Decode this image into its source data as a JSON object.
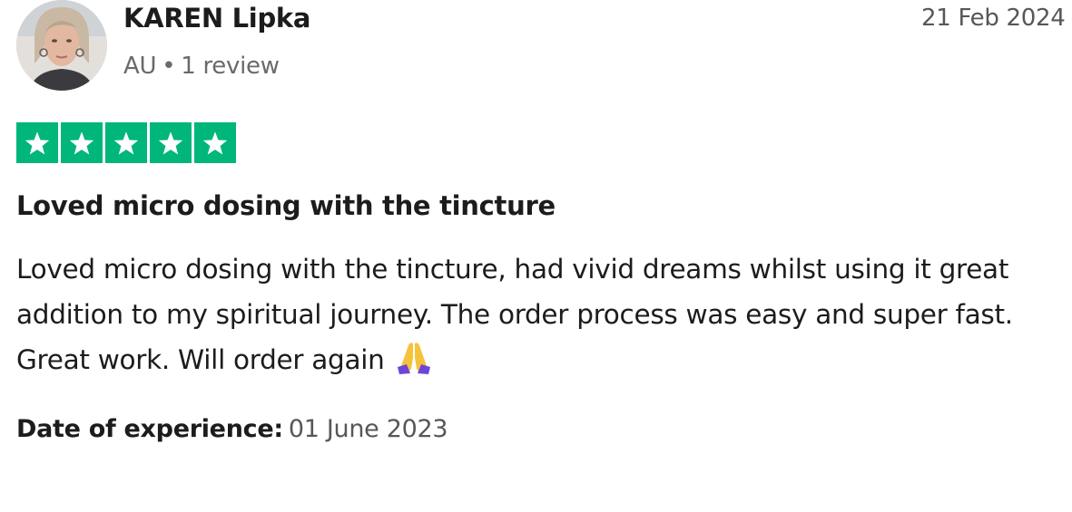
{
  "reviewer": {
    "name": "KAREN Lipka",
    "country": "AU",
    "separator": "•",
    "review_count": "1 review"
  },
  "review": {
    "date": "21 Feb 2024",
    "rating": 5,
    "rating_max": 5,
    "star_color": "#00b67a",
    "title": "Loved micro dosing with the tincture",
    "body": "Loved micro dosing with the tincture, had vivid dreams whilst using it great addition to my spiritual journey. The order process was easy and super fast. Great work. Will order again",
    "emoji": "folded-hands-icon"
  },
  "experience": {
    "label": "Date of experience:",
    "value": "01 June 2023"
  }
}
